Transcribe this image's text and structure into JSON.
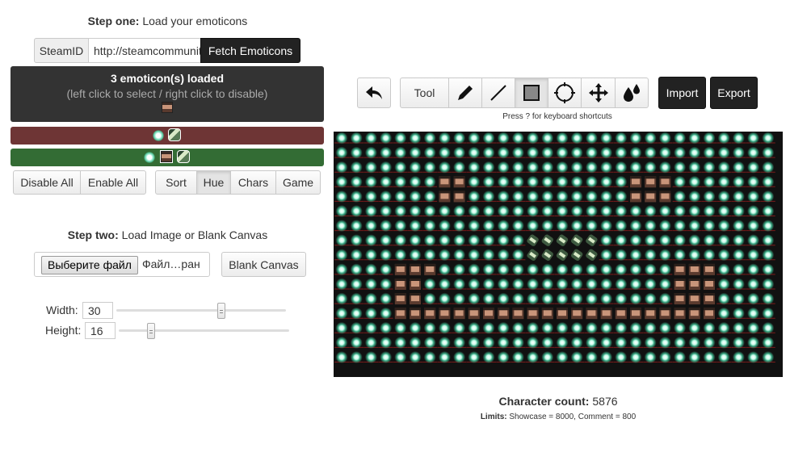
{
  "step_one": {
    "bold": "Step one:",
    "text": " Load your emoticons"
  },
  "steam": {
    "label": "SteamID",
    "value": "http://steamcommunity.com/",
    "fetch": "Fetch Emoticons"
  },
  "loaded": {
    "count_text": "3 emoticon(s) loaded",
    "hint": "(left click to select / right click to disable)"
  },
  "filters": {
    "disable_all": "Disable All",
    "enable_all": "Enable All",
    "sort": "Sort",
    "hue": "Hue",
    "chars": "Chars",
    "game": "Game"
  },
  "step_two": {
    "bold": "Step two:",
    "text": " Load Image or Blank Canvas"
  },
  "file": {
    "choose": "Выберите файл",
    "status": "Файл…ран",
    "blank": "Blank Canvas"
  },
  "dims": {
    "width_label": "Width:",
    "width": "30",
    "height_label": "Height:",
    "height": "16",
    "width_level": 0.65,
    "height_level": 0.2
  },
  "toolbar": {
    "tool": "Tool",
    "import": "Import",
    "export": "Export",
    "shortcut_hint": "Press ? for keyboard shortcuts"
  },
  "status": {
    "count_label": "Character count:",
    "count": " 5876",
    "limits_label": "Limits:",
    "limits": " Showcase = 8000, Comment = 800"
  },
  "colors": {
    "bg_bar_red": "#6e3535",
    "fg_bar_green": "#336c34",
    "canvas_bg": "#111111",
    "panel_dark": "#333333"
  },
  "canvas": {
    "cols": 30,
    "rows": 16
  }
}
